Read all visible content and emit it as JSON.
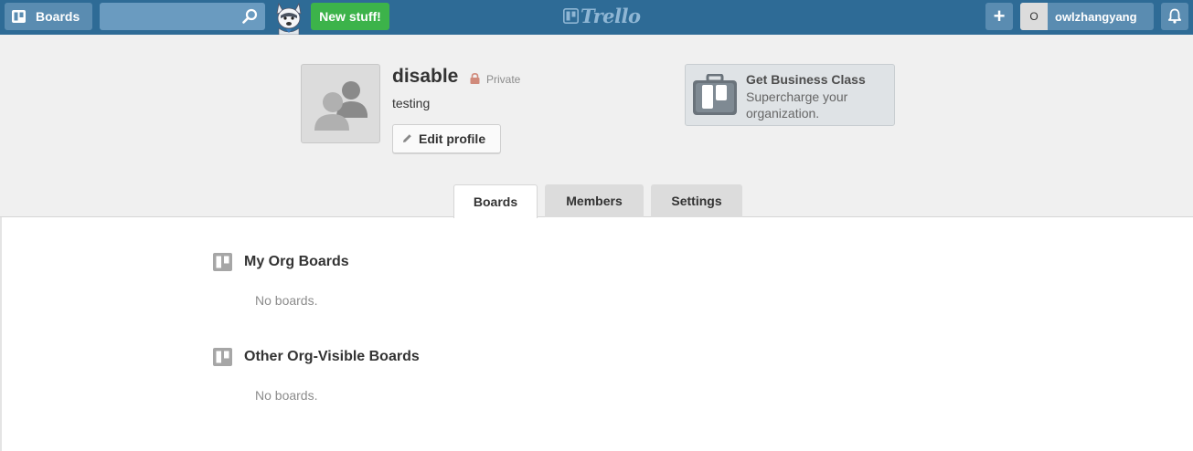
{
  "header": {
    "boards_label": "Boards",
    "search_placeholder": "",
    "new_stuff_label": "New stuff!",
    "logo_text": "Trello",
    "add_label": "+",
    "member_initial": "O",
    "member_name": "owlzhangyang",
    "colors": {
      "bar": "#2e6b96",
      "button": "#5a8cb1",
      "new_stuff": "#3cb34a"
    }
  },
  "profile": {
    "name": "disable",
    "visibility": "Private",
    "description": "testing",
    "edit_label": "Edit profile",
    "avatar_icon": "org-members-icon",
    "visibility_icon": "lock-icon",
    "visibility_color": "#d08a7b"
  },
  "business_card": {
    "title": "Get Business Class",
    "subtitle": "Supercharge your organization.",
    "icon": "briefcase-icon"
  },
  "tabs": [
    {
      "label": "Boards",
      "active": true
    },
    {
      "label": "Members",
      "active": false
    },
    {
      "label": "Settings",
      "active": false
    }
  ],
  "sections": [
    {
      "title": "My Org Boards",
      "empty_text": "No boards.",
      "icon": "board-icon"
    },
    {
      "title": "Other Org-Visible Boards",
      "empty_text": "No boards.",
      "icon": "board-icon"
    }
  ]
}
